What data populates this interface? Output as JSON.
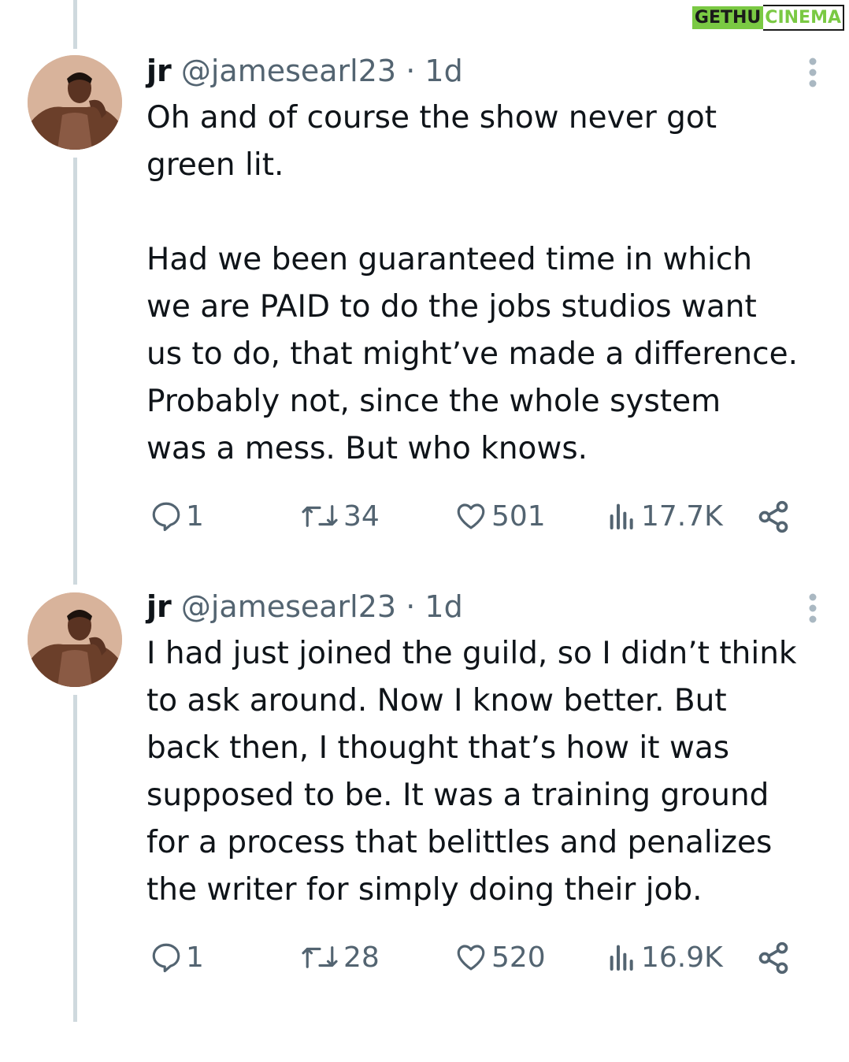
{
  "watermark": {
    "part1": "GETHU",
    "part2": "CINEMA"
  },
  "tweets": [
    {
      "name": "jr",
      "handle": "@jamesearl23",
      "sep": "·",
      "time": "1d",
      "text": "Oh and of course the show never got\ngreen lit.\n\nHad we been guaranteed time in which\nwe are PAID to do the jobs studios want\nus to do, that might’ve made a difference.\nProbably not, since the whole system\nwas a mess. But who knows.",
      "replies": "1",
      "retweets": "34",
      "likes": "501",
      "views": "17.7K"
    },
    {
      "name": "jr",
      "handle": "@jamesearl23",
      "sep": "·",
      "time": "1d",
      "text": "I had just joined the guild, so I didn’t think\nto ask around. Now I know better. But\nback then, I thought that’s how it was\nsupposed to be. It was a training ground\nfor a process that belittles and penalizes\nthe writer for simply doing their job.",
      "replies": "1",
      "retweets": "28",
      "likes": "520",
      "views": "16.9K"
    }
  ],
  "colors": {
    "text": "#0f1419",
    "muted": "#536471",
    "thread": "#cfd9de",
    "brand": "#7ac943"
  },
  "icons": [
    "reply-icon",
    "retweet-icon",
    "like-icon",
    "views-icon",
    "share-icon",
    "more-icon"
  ]
}
